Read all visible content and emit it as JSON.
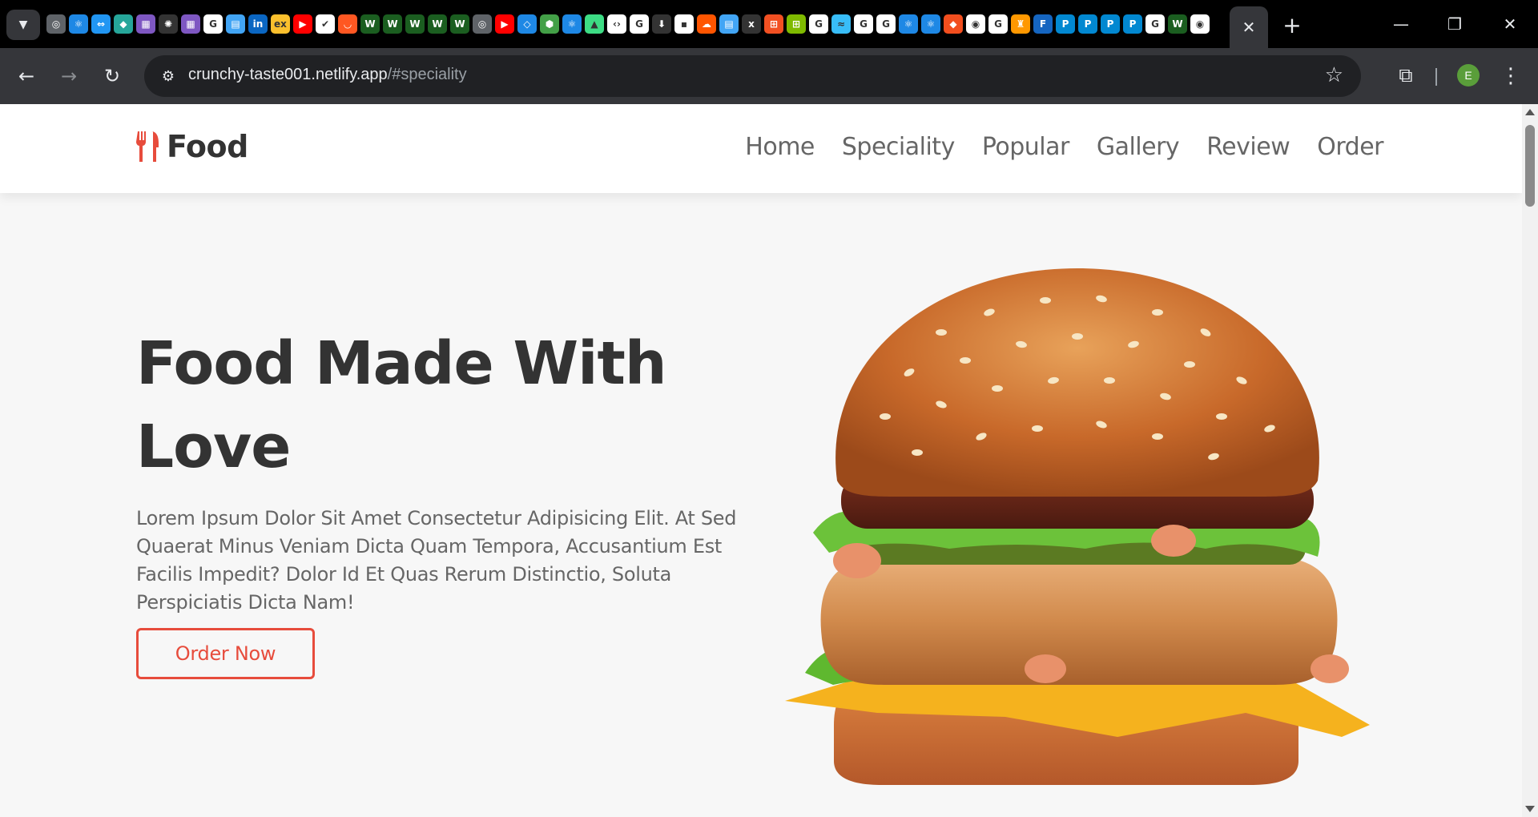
{
  "browser": {
    "url_domain": "crunchy-taste001.netlify.app",
    "url_path": "/#speciality",
    "profile_initial": "E",
    "tab_favicons": [
      {
        "icon": "globe-icon",
        "color": "#5f6368",
        "glyph": "◎"
      },
      {
        "icon": "react-icon",
        "color": "#1e88e5",
        "glyph": "⚛"
      },
      {
        "icon": "link-icon",
        "color": "#2196f3",
        "glyph": "⇔"
      },
      {
        "icon": "diamond-icon",
        "color": "#26a69a",
        "glyph": "◆"
      },
      {
        "icon": "image-icon",
        "color": "#7e57c2",
        "glyph": "▦"
      },
      {
        "icon": "openai-icon",
        "color": "#333333",
        "glyph": "✺"
      },
      {
        "icon": "image-icon",
        "color": "#7e57c2",
        "glyph": "▦"
      },
      {
        "icon": "google-icon",
        "color": "#ffffff",
        "glyph": "G"
      },
      {
        "icon": "grid-icon",
        "color": "#42a5f5",
        "glyph": "▤"
      },
      {
        "icon": "linkedin-icon",
        "color": "#0a66c2",
        "glyph": "in"
      },
      {
        "icon": "ex-icon",
        "color": "#fbc02d",
        "glyph": "ex"
      },
      {
        "icon": "youtube-icon",
        "color": "#ff0000",
        "glyph": "▶"
      },
      {
        "icon": "check-icon",
        "color": "#ffffff",
        "glyph": "✔"
      },
      {
        "icon": "mug-icon",
        "color": "#ff5722",
        "glyph": "◡"
      },
      {
        "icon": "w-icon",
        "color": "#1b5e20",
        "glyph": "W"
      },
      {
        "icon": "w-icon",
        "color": "#1b5e20",
        "glyph": "W"
      },
      {
        "icon": "w-icon",
        "color": "#1b5e20",
        "glyph": "W"
      },
      {
        "icon": "w-icon",
        "color": "#1b5e20",
        "glyph": "W"
      },
      {
        "icon": "w-icon",
        "color": "#1b5e20",
        "glyph": "W"
      },
      {
        "icon": "globe-icon",
        "color": "#5f6368",
        "glyph": "◎"
      },
      {
        "icon": "youtube-icon",
        "color": "#ff0000",
        "glyph": "▶"
      },
      {
        "icon": "vscode-icon",
        "color": "#1e88e5",
        "glyph": "◇"
      },
      {
        "icon": "node-icon",
        "color": "#43a047",
        "glyph": "⬢"
      },
      {
        "icon": "react-icon",
        "color": "#1e88e5",
        "glyph": "⚛"
      },
      {
        "icon": "android-icon",
        "color": "#3ddc84",
        "glyph": "▲"
      },
      {
        "icon": "code-icon",
        "color": "#ffffff",
        "glyph": "‹›"
      },
      {
        "icon": "google-icon",
        "color": "#ffffff",
        "glyph": "G"
      },
      {
        "icon": "download-icon",
        "color": "#333333",
        "glyph": "⬇"
      },
      {
        "icon": "square-icon",
        "color": "#ffffff",
        "glyph": "▪"
      },
      {
        "icon": "soundcloud-icon",
        "color": "#ff5500",
        "glyph": "☁"
      },
      {
        "icon": "grid-icon",
        "color": "#42a5f5",
        "glyph": "▤"
      },
      {
        "icon": "xfs-icon",
        "color": "#333333",
        "glyph": "x"
      },
      {
        "icon": "microsoft-icon",
        "color": "#f25022",
        "glyph": "⊞"
      },
      {
        "icon": "microsoft-icon",
        "color": "#7fba00",
        "glyph": "⊞"
      },
      {
        "icon": "google-icon",
        "color": "#ffffff",
        "glyph": "G"
      },
      {
        "icon": "tailwind-icon",
        "color": "#38bdf8",
        "glyph": "≈"
      },
      {
        "icon": "google-icon",
        "color": "#ffffff",
        "glyph": "G"
      },
      {
        "icon": "google-icon",
        "color": "#ffffff",
        "glyph": "G"
      },
      {
        "icon": "react-icon",
        "color": "#1e88e5",
        "glyph": "⚛"
      },
      {
        "icon": "react-icon",
        "color": "#1e88e5",
        "glyph": "⚛"
      },
      {
        "icon": "figma-icon",
        "color": "#f24e1e",
        "glyph": "◆"
      },
      {
        "icon": "chrome-icon",
        "color": "#ffffff",
        "glyph": "◉"
      },
      {
        "icon": "google-icon",
        "color": "#ffffff",
        "glyph": "G"
      },
      {
        "icon": "figure-icon",
        "color": "#ff9800",
        "glyph": "♜"
      },
      {
        "icon": "f-icon",
        "color": "#1565c0",
        "glyph": "F"
      },
      {
        "icon": "p-icon",
        "color": "#0288d1",
        "glyph": "P"
      },
      {
        "icon": "p-icon",
        "color": "#0288d1",
        "glyph": "P"
      },
      {
        "icon": "p-icon",
        "color": "#0288d1",
        "glyph": "P"
      },
      {
        "icon": "p-icon",
        "color": "#0288d1",
        "glyph": "P"
      },
      {
        "icon": "google-icon",
        "color": "#ffffff",
        "glyph": "G"
      },
      {
        "icon": "w-icon",
        "color": "#1b5e20",
        "glyph": "W"
      },
      {
        "icon": "chrome-icon",
        "color": "#ffffff",
        "glyph": "◉"
      }
    ]
  },
  "site": {
    "logo_text": "Food",
    "nav": [
      "Home",
      "Speciality",
      "Popular",
      "Gallery",
      "Review",
      "Order"
    ],
    "hero": {
      "title_line1": "Food Made With",
      "title_line2": "Love",
      "description": "Lorem Ipsum Dolor Sit Amet Consectetur Adipisicing Elit. At Sed Quaerat Minus Veniam Dicta Quam Tempora, Accusantium Est Facilis Impedit? Dolor Id Et Quas Rerum Distinctio, Soluta Perspiciatis Dicta Nam!",
      "button_label": "Order Now"
    },
    "accent_color": "#e74c3c"
  }
}
